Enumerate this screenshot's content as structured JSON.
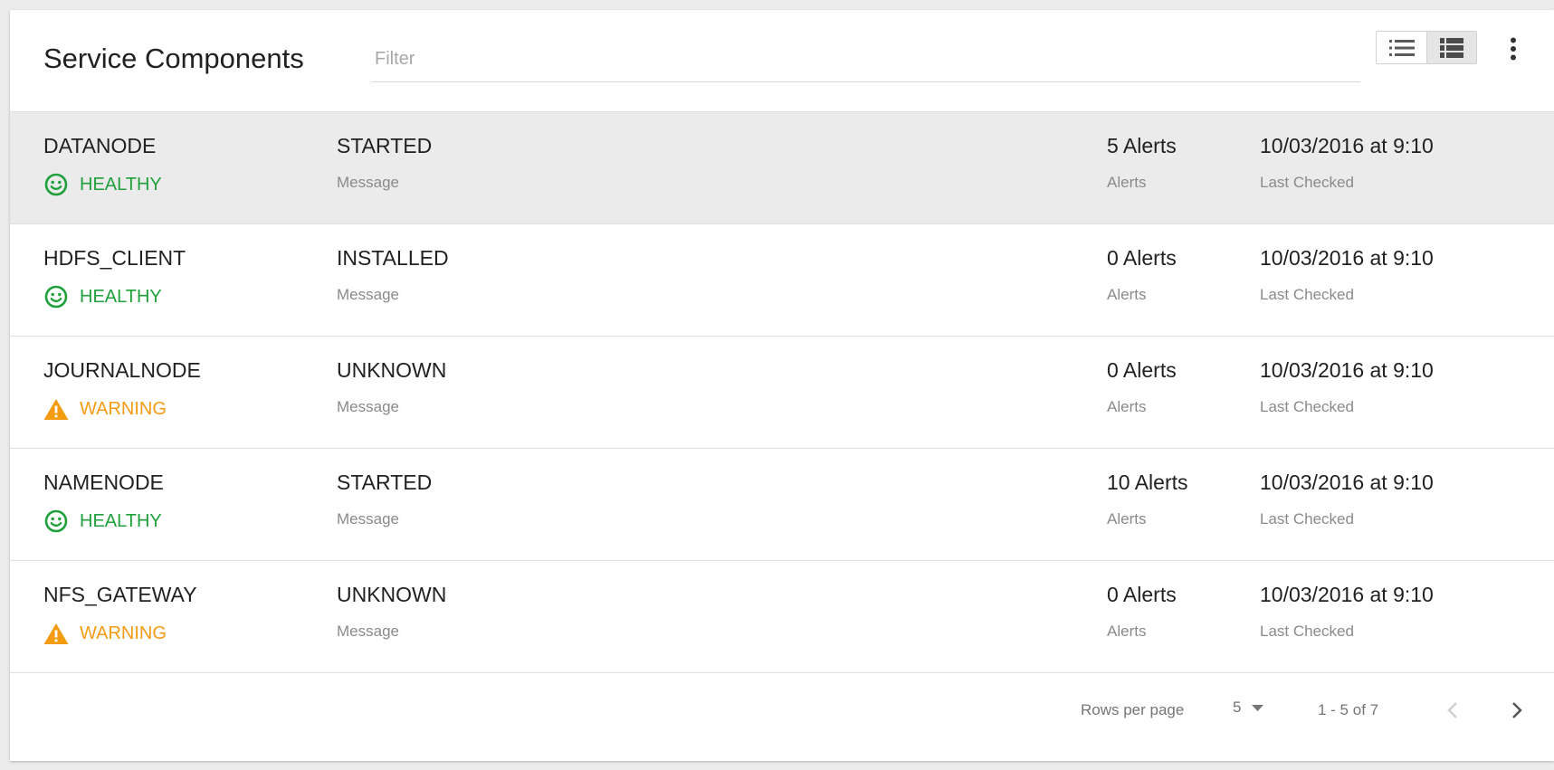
{
  "header": {
    "title": "Service Components",
    "filter_placeholder": "Filter",
    "filter_value": ""
  },
  "view_toggle": {
    "list_icon": "list-view-icon",
    "detail_icon": "detail-list-view-icon",
    "active": "detail"
  },
  "more_icon": "more-vert-icon",
  "colors": {
    "healthy": "#1fa03c",
    "warning": "#f39c12",
    "selected_row": "#ebebeb"
  },
  "rows": [
    {
      "name": "DATANODE",
      "health": "HEALTHY",
      "health_icon": "smiley-icon",
      "status": "STARTED",
      "message": "Message",
      "alerts": "5 Alerts",
      "alerts_label": "Alerts",
      "date": "10/03/2016 at 9:10",
      "date_label": "Last Checked",
      "selected": true
    },
    {
      "name": "HDFS_CLIENT",
      "health": "HEALTHY",
      "health_icon": "smiley-icon",
      "status": "INSTALLED",
      "message": "Message",
      "alerts": "0 Alerts",
      "alerts_label": "Alerts",
      "date": "10/03/2016 at 9:10",
      "date_label": "Last Checked",
      "selected": false
    },
    {
      "name": "JOURNALNODE",
      "health": "WARNING",
      "health_icon": "warning-icon",
      "status": "UNKNOWN",
      "message": "Message",
      "alerts": "0 Alerts",
      "alerts_label": "Alerts",
      "date": "10/03/2016 at 9:10",
      "date_label": "Last Checked",
      "selected": false
    },
    {
      "name": "NAMENODE",
      "health": "HEALTHY",
      "health_icon": "smiley-icon",
      "status": "STARTED",
      "message": "Message",
      "alerts": "10 Alerts",
      "alerts_label": "Alerts",
      "date": "10/03/2016 at 9:10",
      "date_label": "Last Checked",
      "selected": false
    },
    {
      "name": "NFS_GATEWAY",
      "health": "WARNING",
      "health_icon": "warning-icon",
      "status": "UNKNOWN",
      "message": "Message",
      "alerts": "0 Alerts",
      "alerts_label": "Alerts",
      "date": "10/03/2016 at 9:10",
      "date_label": "Last Checked",
      "selected": false
    }
  ],
  "pagination": {
    "rows_per_page_label": "Rows per page",
    "rows_per_page_value": "5",
    "range": "1 - 5 of 7",
    "prev_icon": "chevron-left-icon",
    "next_icon": "chevron-right-icon"
  }
}
